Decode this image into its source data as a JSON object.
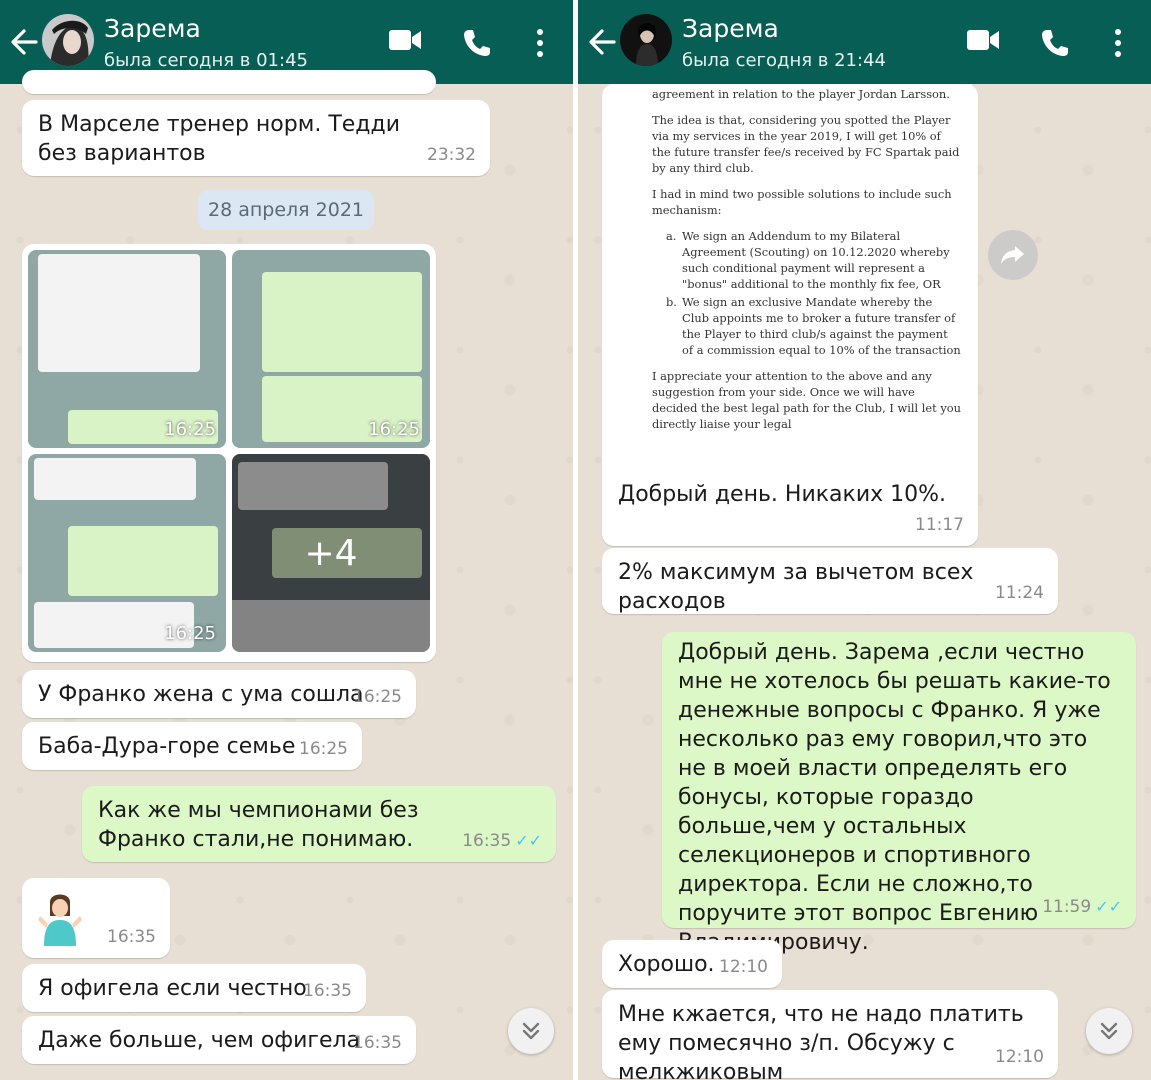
{
  "left": {
    "contact_name": "Зарема",
    "status": "была сегодня в 01:45",
    "messages": [
      {
        "text": "В Марселе тренер норм. Тедди без вариантов",
        "time": "23:32"
      },
      {
        "date_chip": "28 апреля 2021 г."
      },
      {
        "album_times": [
          "16:25",
          "16:25",
          "16:25"
        ],
        "more_count": "+4"
      },
      {
        "text": "У Франко жена с ума сошла",
        "time": "16:25"
      },
      {
        "text": "Баба-Дура-горе семье",
        "time": "16:25"
      },
      {
        "text": "Как же мы чемпионами без Франко стали,не понимаю.",
        "time": "16:35"
      },
      {
        "emoji": "person-shrugging-emoji",
        "time": "16:35"
      },
      {
        "text": "Я офигела если честно",
        "time": "16:35"
      },
      {
        "text": "Даже больше, чем офигела",
        "time": "16:35"
      }
    ]
  },
  "right": {
    "contact_name": "Зарема",
    "status": "была сегодня в 21:44",
    "document": {
      "p1": "agreement in relation to the player Jordan Larsson.",
      "p2": "The idea is that, considering you spotted the Player via my services in the year 2019, I will get 10% of the future transfer fee/s received by FC Spartak paid by any third club.",
      "p3": "I had in mind two possible solutions to include such mechanism:",
      "item_a_marker": "a.",
      "item_a": "We sign an Addendum to my Bilateral Agreement (Scouting) on 10.12.2020 whereby such conditional payment will represent a \"bonus\" additional to the monthly fix fee, OR",
      "item_b_marker": "b.",
      "item_b": "We sign an exclusive Mandate whereby the Club appoints me to broker a future transfer of the Player to third club/s against the payment of a commission equal to 10% of the transaction",
      "p4": "I appreciate your attention to the above and any suggestion from your side. Once we will have decided the best legal path for the Club, I will let you directly liaise your legal"
    },
    "messages": [
      {
        "text": "Добрый день. Никаких 10%.",
        "time": "11:17"
      },
      {
        "text": "2% максимум за вычетом всех расходов",
        "time": "11:24"
      },
      {
        "text": "Добрый день. Зарема ,если честно мне не хотелось бы решать какие-то денежные вопросы с Франко. Я  уже несколько раз ему говорил,что это не в моей власти определять его бонусы, которые гораздо больше,чем у остальных селекционеров и спортивного директора. Если не сложно,то поручите этот вопрос Евгению Владимировичу.",
        "time": "11:59"
      },
      {
        "text": "Хорошо.",
        "time": "12:10"
      },
      {
        "text": "Мне кжается, что не надо платить ему помесячно з/п. Обсужу с мелкжиковым",
        "time": "12:10"
      }
    ]
  },
  "colors": {
    "header": "#075e54",
    "incoming": "#ffffff",
    "outgoing": "#dcf8c6",
    "read_ticks": "#4fc3f7",
    "date_chip": "#dbe8f3",
    "wallpaper": "#e8dfd4"
  }
}
